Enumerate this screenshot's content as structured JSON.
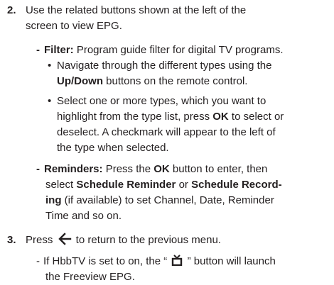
{
  "step2": {
    "number": "2.",
    "line1": "Use the related buttons shown at the left of the",
    "line2": "screen to view EPG."
  },
  "filter": {
    "dash": "-",
    "label": "Filter:",
    "line1_rest": " Program guide filter for digital TV programs.",
    "bullet1": {
      "line1": "Navigate through the different types using the",
      "line2_bold": "Up/Down",
      "line2_rest": " buttons on the remote control."
    },
    "bullet2": {
      "line1": "Select one or more types, which you want to",
      "line2_pre": "highlight from the type list, press ",
      "line2_bold": "OK",
      "line2_post": " to select or",
      "line3": "deselect. A checkmark will appear to the left of",
      "line4": "the type when selected."
    }
  },
  "reminders": {
    "dash": "-",
    "label": "Reminders:",
    "line1_pre": " Press the ",
    "line1_bold": "OK",
    "line1_post": " button to enter, then",
    "line2_pre": "select ",
    "line2_bold1": "Schedule Reminder",
    "line2_mid": " or ",
    "line2_bold2": "Schedule Record-",
    "line3_bold": "ing",
    "line3_rest": "  (if available) to set Channel, Date, Reminder",
    "line4": "Time and so on."
  },
  "step3": {
    "number": "3.",
    "pre": "Press ",
    "icon": "back-arrow-icon",
    "post": " to return to the previous menu."
  },
  "hbbtv": {
    "dash": "-",
    "line1_pre": "If HbbTV is set to on, the “ ",
    "icon": "tv-icon",
    "line1_post": " ” button will launch",
    "line2": "the Freeview EPG."
  },
  "bullet_char": "•"
}
